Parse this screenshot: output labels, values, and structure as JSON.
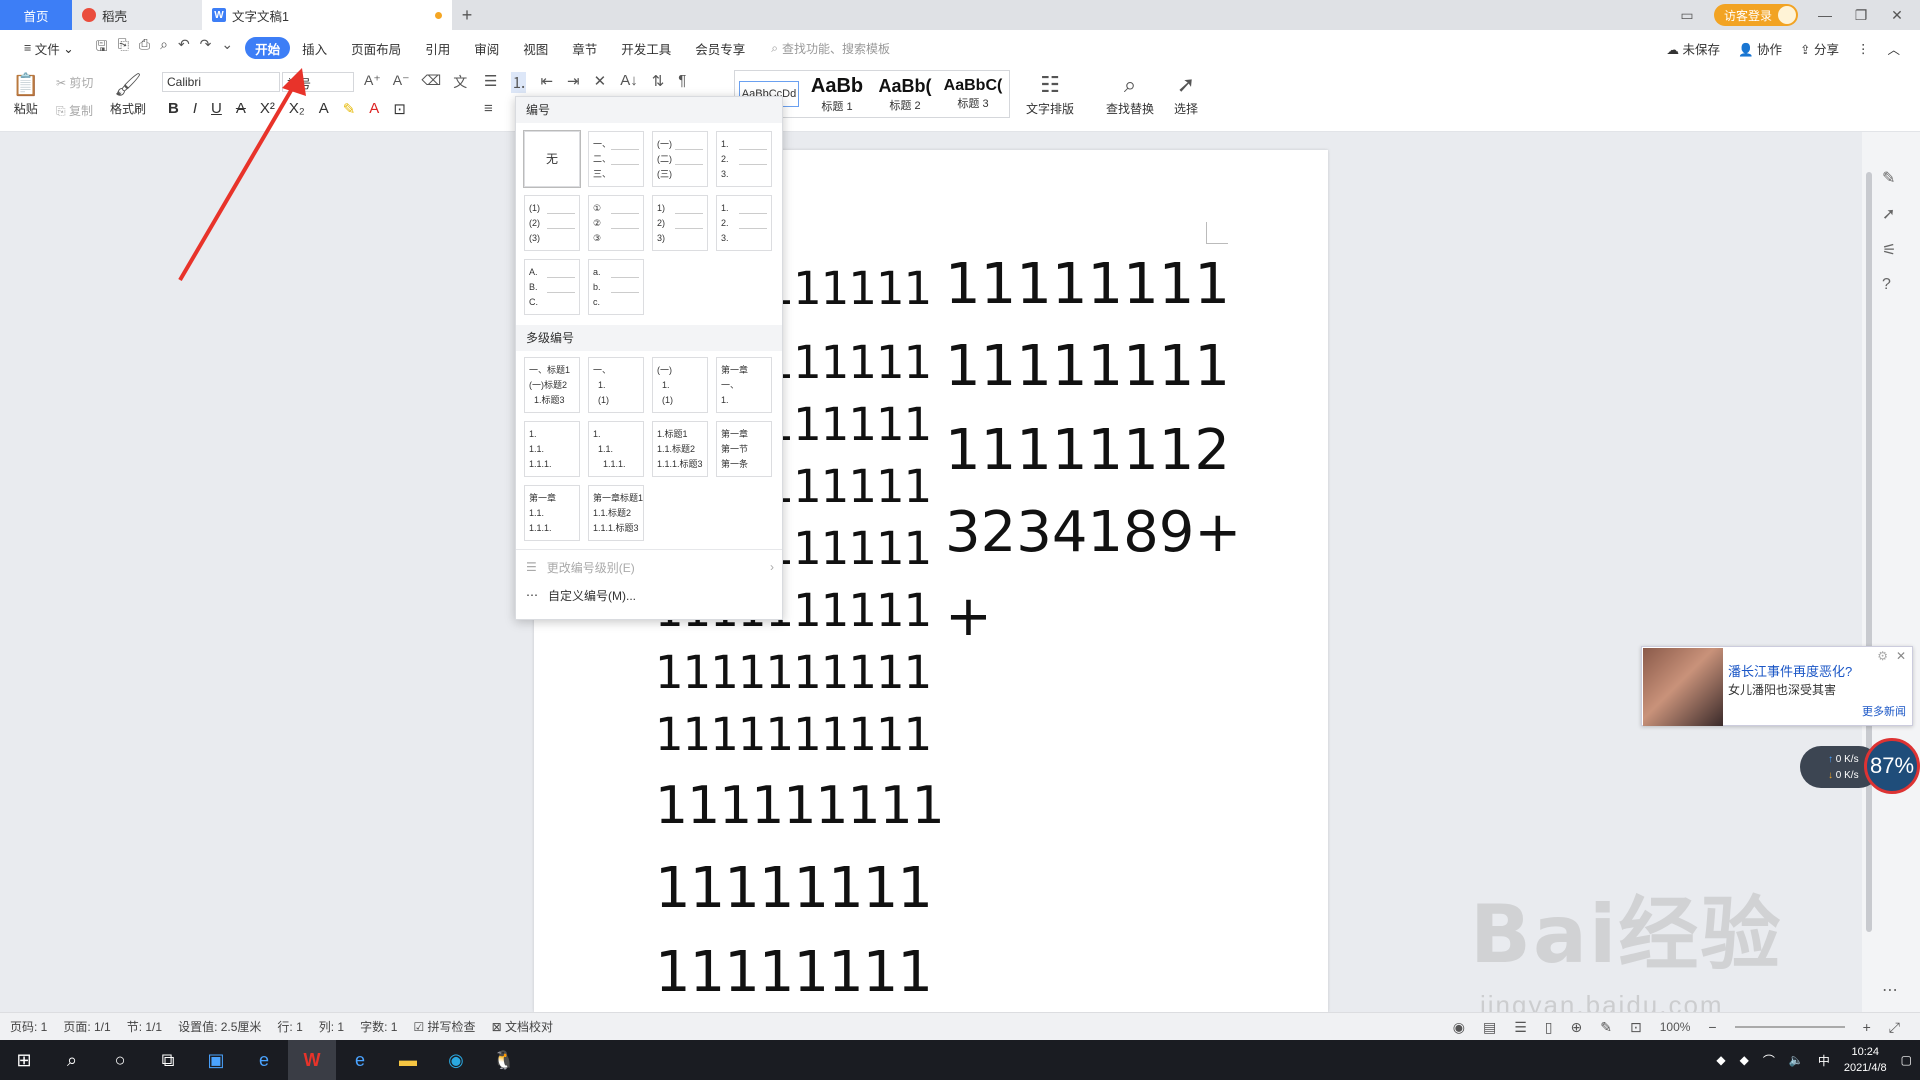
{
  "tabs": {
    "home": "首页",
    "daoke": "稻壳",
    "doc": "文字文稿1"
  },
  "titlebar": {
    "login": "访客登录"
  },
  "menu": {
    "file": "文件",
    "items": [
      "开始",
      "插入",
      "页面布局",
      "引用",
      "审阅",
      "视图",
      "章节",
      "开发工具",
      "会员专享"
    ],
    "search": "查找功能、搜索模板",
    "unsaved": "未保存",
    "collab": "协作",
    "share": "分享"
  },
  "ribbon": {
    "paste": "粘贴",
    "cut": "剪切",
    "copy": "复制",
    "format_painter": "格式刷",
    "font": "Calibri",
    "size": "初号",
    "styles": [
      {
        "preview": "AaBbCcDd",
        "label": ""
      },
      {
        "preview": "AaBb",
        "label": "标题 1"
      },
      {
        "preview": "AaBb(",
        "label": "标题 2"
      },
      {
        "preview": "AaBbC(",
        "label": "标题 3"
      }
    ],
    "text_layout": "文字排版",
    "find_replace": "查找替换",
    "select": "选择"
  },
  "dropdown": {
    "numbering_title": "编号",
    "none": "无",
    "numbering": [
      "一、\n二、\n三、",
      "(一)\n(二)\n(三)",
      "1.\n2.\n3.",
      "(1)\n(2)\n(3)",
      "①\n②\n③",
      "1)\n2)\n3)",
      "1.\n2.\n3.",
      "A.\nB.\nC.",
      "a.\nb.\nc."
    ],
    "multilevel_title": "多级编号",
    "multilevel": [
      "一、标题1\n(一)标题2\n  1.标题3",
      "一、\n  1.\n  (1)",
      "(一)\n  1.\n  (1)",
      "第一章\n一、\n1.",
      "1.\n1.1.\n1.1.1.",
      "1.\n  1.1.\n    1.1.1.",
      "1.标题1\n1.1.标题2\n1.1.1.标题3",
      "第一章\n第一节\n第一条",
      "第一章\n1.1.\n1.1.1.",
      "第一章标题1\n1.1.标题2\n1.1.1.标题3"
    ],
    "change_level": "更改编号级别(E)",
    "custom": "自定义编号(M)..."
  },
  "document": {
    "left_lines": [
      "1111111111",
      "1111111111",
      "1111111111",
      "1111111111",
      "1111111111",
      "1111111111",
      "1111111111",
      "1111111111",
      "111111111",
      "11111111",
      "11111111"
    ],
    "right_lines": [
      "11111111",
      "11111111",
      "11111112",
      "3234189+",
      "+"
    ]
  },
  "news": {
    "title": "潘长江事件再度恶化?",
    "subtitle": "女儿潘阳也深受其害",
    "more": "更多新闻"
  },
  "speed": {
    "up": "0 K/s",
    "down": "0 K/s",
    "percent": "87%"
  },
  "status": {
    "page": "页码: 1",
    "pages": "页面: 1/1",
    "section": "节: 1/1",
    "setting": "设置值: 2.5厘米",
    "row": "行: 1",
    "col": "列: 1",
    "words": "字数: 1",
    "spell": "拼写检查",
    "proof": "文档校对",
    "zoom": "100%"
  },
  "taskbar": {
    "time": "10:24",
    "date": "2021/4/8",
    "ime": "中"
  },
  "watermark": {
    "main": "Bai经验",
    "sub": "jingyan.baidu.com"
  }
}
